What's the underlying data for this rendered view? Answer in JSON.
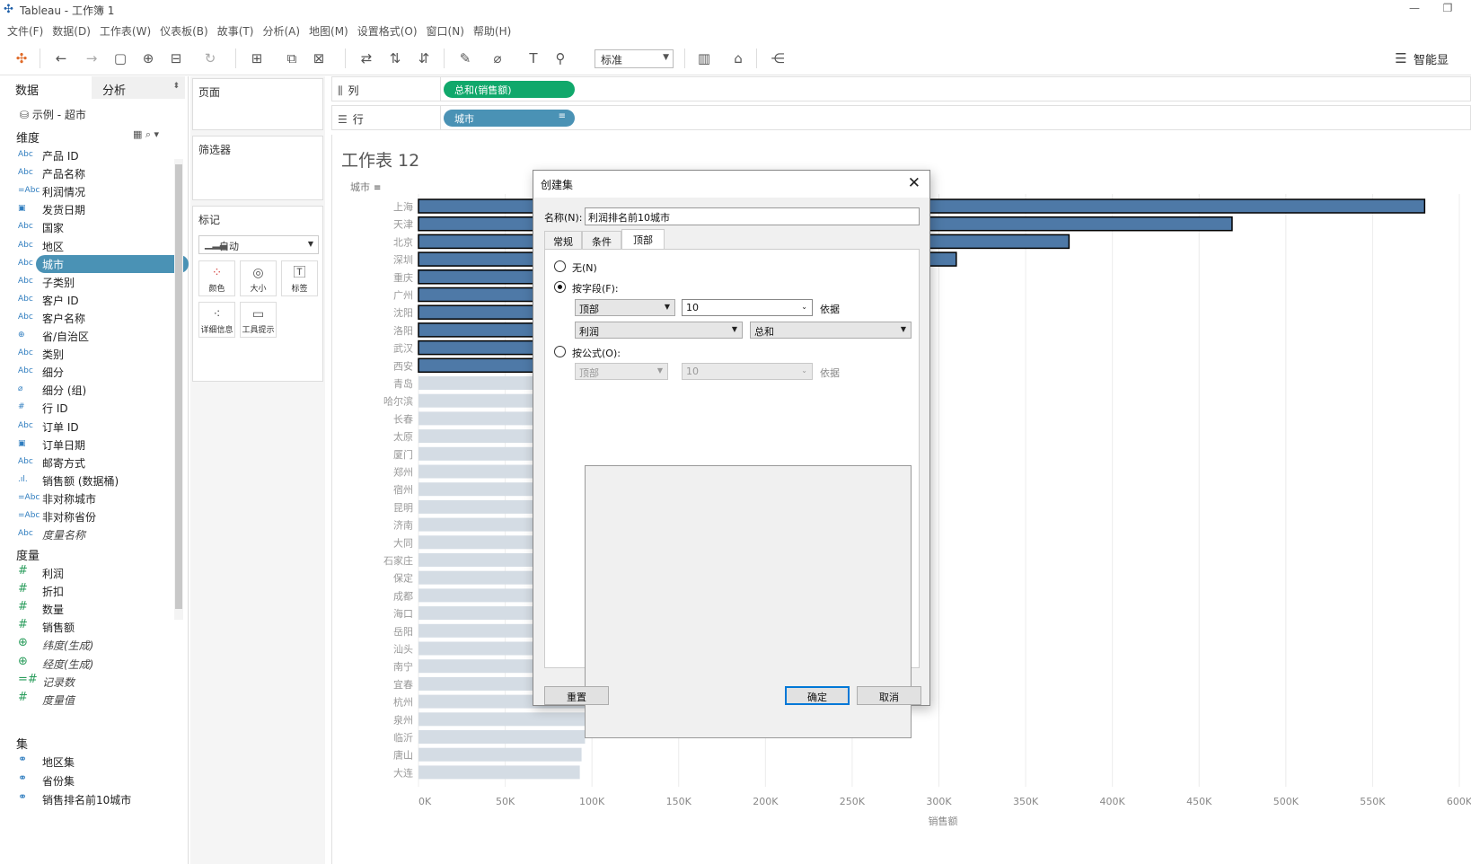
{
  "app": {
    "title": "Tableau - 工作簿 1",
    "menu": [
      "文件(F)",
      "数据(D)",
      "工作表(W)",
      "仪表板(B)",
      "故事(T)",
      "分析(A)",
      "地图(M)",
      "设置格式(O)",
      "窗口(N)",
      "帮助(H)"
    ],
    "fit_value": "标准",
    "smart_label": "智能显"
  },
  "data_pane": {
    "tab_data": "数据",
    "tab_analysis": "分析",
    "source": "示例 - 超市",
    "dimensions_header": "维度",
    "measures_header": "度量",
    "sets_header": "集",
    "dimensions": [
      {
        "icon": "Abc",
        "name": "产品 ID"
      },
      {
        "icon": "Abc",
        "name": "产品名称"
      },
      {
        "icon": "=Abc",
        "name": "利润情况"
      },
      {
        "icon": "date",
        "name": "发货日期"
      },
      {
        "icon": "Abc",
        "name": "国家"
      },
      {
        "icon": "Abc",
        "name": "地区"
      },
      {
        "icon": "Abc",
        "name": "城市"
      },
      {
        "icon": "Abc",
        "name": "子类别"
      },
      {
        "icon": "Abc",
        "name": "客户 ID"
      },
      {
        "icon": "Abc",
        "name": "客户名称"
      },
      {
        "icon": "globe",
        "name": "省/自治区"
      },
      {
        "icon": "Abc",
        "name": "类别"
      },
      {
        "icon": "Abc",
        "name": "细分"
      },
      {
        "icon": "clip",
        "name": "细分 (组)"
      },
      {
        "icon": "#",
        "name": "行 ID"
      },
      {
        "icon": "Abc",
        "name": "订单 ID"
      },
      {
        "icon": "date",
        "name": "订单日期"
      },
      {
        "icon": "Abc",
        "name": "邮寄方式"
      },
      {
        "icon": "bins",
        "name": "销售额 (数据桶)"
      },
      {
        "icon": "=Abc",
        "name": "非对称城市"
      },
      {
        "icon": "=Abc",
        "name": "非对称省份"
      },
      {
        "icon": "Abc",
        "name": "度量名称"
      }
    ],
    "measures": [
      {
        "icon": "#",
        "name": "利润"
      },
      {
        "icon": "#",
        "name": "折扣"
      },
      {
        "icon": "#",
        "name": "数量"
      },
      {
        "icon": "#",
        "name": "销售额"
      },
      {
        "icon": "globe",
        "name": "纬度(生成)"
      },
      {
        "icon": "globe",
        "name": "经度(生成)"
      },
      {
        "icon": "=#",
        "name": "记录数"
      },
      {
        "icon": "#",
        "name": "度量值"
      }
    ],
    "sets": [
      "地区集",
      "省份集",
      "销售排名前10城市"
    ]
  },
  "cards": {
    "pages": "页面",
    "filters": "筛选器",
    "marks": "标记",
    "mark_type": "自动",
    "mark_buttons": [
      "颜色",
      "大小",
      "标签",
      "详细信息",
      "工具提示"
    ]
  },
  "shelves": {
    "columns_label": "列",
    "rows_label": "行",
    "columns_pill": "总和(销售额)",
    "rows_pill": "城市"
  },
  "worksheet": {
    "title": "工作表 12"
  },
  "chart_data": {
    "type": "bar",
    "orientation": "horizontal",
    "ylabel": "城市",
    "xlabel": "销售额",
    "xlim": [
      0,
      600000
    ],
    "xticks": [
      "0K",
      "50K",
      "100K",
      "150K",
      "200K",
      "250K",
      "300K",
      "350K",
      "400K",
      "450K",
      "500K",
      "550K",
      "600K"
    ],
    "categories": [
      "上海",
      "天津",
      "北京",
      "深圳",
      "重庆",
      "广州",
      "沈阳",
      "洛阳",
      "武汉",
      "西安",
      "青岛",
      "哈尔滨",
      "长春",
      "太原",
      "厦门",
      "郑州",
      "宿州",
      "昆明",
      "济南",
      "大同",
      "石家庄",
      "保定",
      "成都",
      "海口",
      "岳阳",
      "汕头",
      "南宁",
      "宜春",
      "杭州",
      "泉州",
      "临沂",
      "唐山",
      "大连"
    ],
    "values": [
      580000,
      469000,
      375000,
      310000,
      280000,
      255000,
      230000,
      215000,
      200000,
      190000,
      160000,
      152000,
      145000,
      140000,
      135000,
      130000,
      127000,
      124000,
      121000,
      118000,
      116000,
      113000,
      111000,
      108000,
      106000,
      104000,
      103000,
      102000,
      101000,
      100000,
      96000,
      94000,
      93000
    ],
    "highlighted_count": 10,
    "colors": {
      "highlight": "#4e79a7",
      "dim": "#d4dce4",
      "outline": "#000000"
    },
    "grid": true
  },
  "dialog": {
    "title": "创建集",
    "name_label": "名称(N):",
    "name_value": "利润排名前10城市",
    "tabs": [
      "常规",
      "条件",
      "顶部"
    ],
    "active_tab": "顶部",
    "radio_none": "无(N)",
    "radio_by_field": "按字段(F):",
    "radio_by_formula": "按公式(O):",
    "field_direction": "顶部",
    "field_count": "10",
    "field_by_label": "依据",
    "field_measure": "利润",
    "field_agg": "总和",
    "formula_direction": "顶部",
    "formula_count": "10",
    "formula_by_label": "依据",
    "btn_reset": "重置",
    "btn_ok": "确定",
    "btn_cancel": "取消"
  }
}
